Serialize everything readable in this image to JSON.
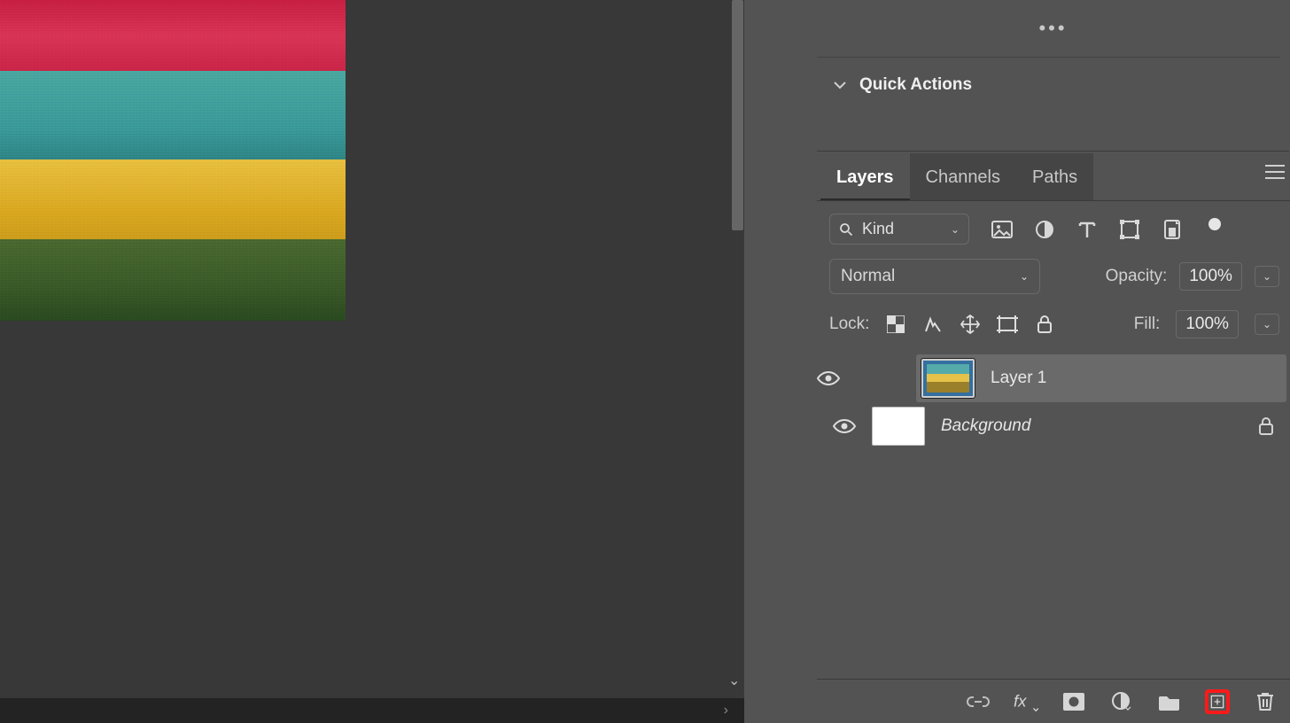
{
  "properties": {
    "menu_ellipsis": "•••",
    "quick_actions": "Quick Actions"
  },
  "tabs": {
    "layers": "Layers",
    "channels": "Channels",
    "paths": "Paths"
  },
  "filter": {
    "label": "Kind"
  },
  "blend": {
    "mode": "Normal",
    "opacity_label": "Opacity:",
    "opacity_value": "100%"
  },
  "lock": {
    "label": "Lock:",
    "fill_label": "Fill:",
    "fill_value": "100%"
  },
  "layers": {
    "items": [
      {
        "name": "Layer 1",
        "locked": false,
        "selected": true
      },
      {
        "name": "Background",
        "locked": true,
        "selected": false
      }
    ]
  }
}
